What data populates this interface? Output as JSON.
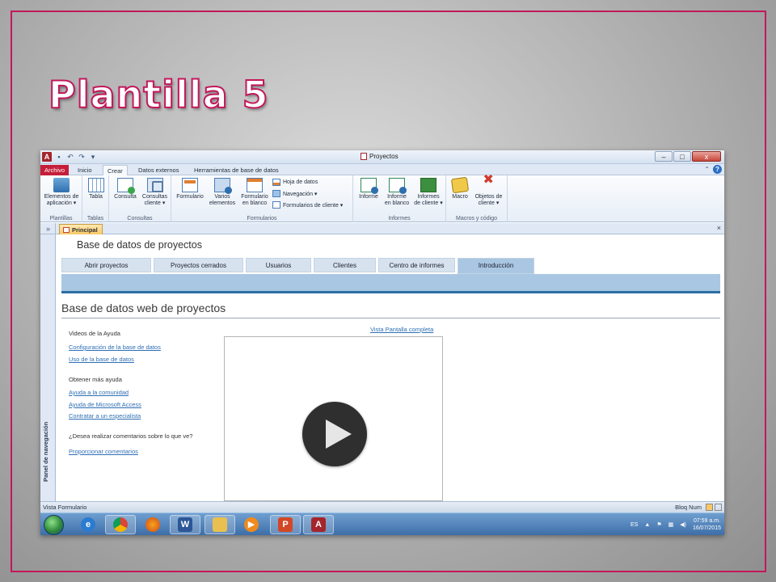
{
  "slide": {
    "title": "Plantilla 5"
  },
  "window": {
    "title": "Proyectos",
    "controls": [
      "–",
      "□",
      "x"
    ]
  },
  "ribbon": {
    "tabs": [
      "Archivo",
      "Inicio",
      "Crear",
      "Datos externos",
      "Herramientas de base de datos"
    ],
    "active_tab": "Crear",
    "groups": [
      {
        "label": "Plantillas",
        "buttons": [
          "Elementos de",
          "aplicación ▾"
        ]
      },
      {
        "label": "Tablas",
        "buttons": [
          "Tabla"
        ]
      },
      {
        "label": "Consultas",
        "buttons": [
          "Consulta",
          "Consultas",
          "cliente ▾"
        ]
      },
      {
        "label": "Formularios",
        "buttons": [
          "Formulario",
          "Varios",
          "elementos",
          "Formulario",
          "en blanco"
        ],
        "small": [
          "Hoja de datos",
          "Navegación ▾",
          "Formularios de cliente ▾"
        ]
      },
      {
        "label": "Informes",
        "buttons": [
          "Informe",
          "Informe",
          "en blanco",
          "Informes",
          "de cliente ▾"
        ]
      },
      {
        "label": "Macros y código",
        "buttons": [
          "Macro",
          "Objetos de",
          "cliente ▾"
        ]
      }
    ]
  },
  "navpane": {
    "label": "Panel de navegación",
    "toggle": "»"
  },
  "document": {
    "tab_label": "Principal",
    "close": "×",
    "form_title": "Base de datos de proyectos",
    "nav_tabs": [
      "Abrir proyectos",
      "Proyectos cerrados",
      "Usuarios",
      "Clientes",
      "Centro de informes",
      "Introducción"
    ],
    "active_nav_tab": "Introducción",
    "section_heading": "Base de datos web de proyectos",
    "full_screen_link": "Vista Pantalla completa",
    "help": {
      "videos_heading": "Videos de la Ayuda",
      "videos_links": [
        "Configuración de la base de datos",
        "Uso de la base de datos"
      ],
      "more_heading": "Obtener más ayuda",
      "more_links": [
        "Ayuda a la comunidad",
        "Ayuda de Microsoft Access",
        "Contratar a un especialista"
      ],
      "feedback_question": "¿Desea realizar comentarios sobre lo que ve?",
      "feedback_link": "Proporcionar comentarios"
    }
  },
  "statusbar": {
    "left": "Vista Formulario",
    "right": "Bloq Num"
  },
  "taskbar": {
    "apps": [
      "start-orb",
      "internet-explorer-icon",
      "chrome-icon",
      "firefox-icon",
      "word-icon",
      "explorer-icon",
      "media-player-icon",
      "powerpoint-icon",
      "access-icon"
    ],
    "language": "ES",
    "time": "07:59 a.m.",
    "date": "16/07/2015"
  },
  "colors": {
    "frame": "#c2185b",
    "file_tab": "#c51e3a",
    "nav_strip": "#a9c7e2",
    "link": "#2f6fb5",
    "taskbar": "#3d6ea8"
  }
}
